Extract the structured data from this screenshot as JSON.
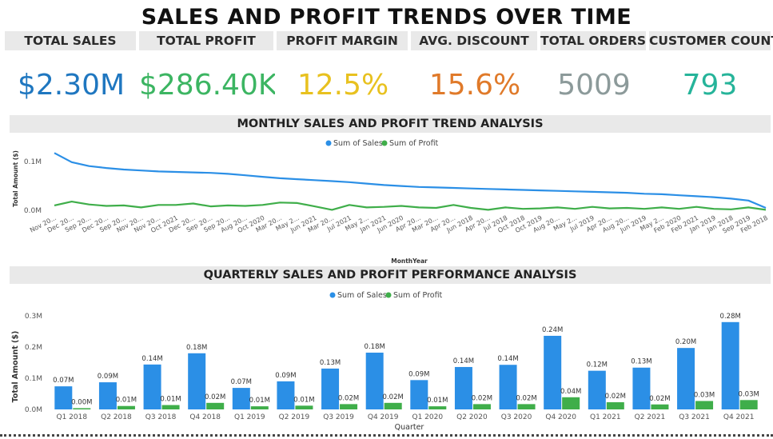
{
  "title": "SALES AND PROFIT TRENDS OVER TIME",
  "kpis": [
    {
      "label": "TOTAL SALES",
      "value": "$2.30M",
      "color": "#1f77c0"
    },
    {
      "label": "TOTAL PROFIT",
      "value": "$286.40K",
      "color": "#3cb562"
    },
    {
      "label": "PROFIT MARGIN",
      "value": "12.5%",
      "color": "#e8c11f"
    },
    {
      "label": "AVG. DISCOUNT",
      "value": "15.6%",
      "color": "#e07a2a"
    },
    {
      "label": "TOTAL ORDERS",
      "value": "5009",
      "color": "#8c9a9a"
    },
    {
      "label": "CUSTOMER COUNT",
      "value": "793",
      "color": "#26b49a"
    }
  ],
  "monthly": {
    "heading": "MONTHLY SALES AND PROFIT TREND ANALYSIS"
  },
  "quarterly": {
    "heading": "QUARTERLY SALES AND PROFIT PERFORMANCE ANALYSIS"
  },
  "chart_data": [
    {
      "type": "line",
      "title": "MONTHLY SALES AND PROFIT TREND ANALYSIS",
      "xlabel": "MonthYear",
      "ylabel": "Total Amount ($)",
      "ylim": [
        0,
        0.13
      ],
      "yticks": [
        {
          "value": 0,
          "label": "0.0M"
        },
        {
          "value": 0.1,
          "label": "0.1M"
        }
      ],
      "legend": "top-center",
      "colors": {
        "Sum of Sales": "#2b8fe6",
        "Sum of Profit": "#3fae4a"
      },
      "x": [
        "Nov 20...",
        "Dec 20...",
        "Sep 20...",
        "Dec 20...",
        "Sep 20...",
        "Nov 20...",
        "Nov 20...",
        "Oct 2021",
        "Dec 20...",
        "Sep 20...",
        "Sep 20...",
        "Aug 20...",
        "Oct 2020",
        "Mar 20...",
        "May 2...",
        "Jun 2021",
        "Mar 20...",
        "Jul 2021",
        "May 2...",
        "Jan 2021",
        "Jun 2020",
        "Apr 20...",
        "Mar 20...",
        "Apr 20...",
        "Jun 2018",
        "Apr 20...",
        "Jul 2018",
        "Oct 2018",
        "Oct 2019",
        "Aug 20...",
        "May 2...",
        "Jul 2019",
        "Apr 20...",
        "Aug 20...",
        "Jun 2019",
        "May 2...",
        "Feb 2020",
        "Feb 2021",
        "Jan 2019",
        "Jan 2018",
        "Sep 2019",
        "Feb 2018"
      ],
      "series": [
        {
          "name": "Sum of Sales",
          "values": [
            0.118,
            0.099,
            0.091,
            0.087,
            0.084,
            0.082,
            0.08,
            0.079,
            0.078,
            0.077,
            0.075,
            0.072,
            0.069,
            0.066,
            0.064,
            0.062,
            0.06,
            0.058,
            0.055,
            0.052,
            0.05,
            0.048,
            0.047,
            0.046,
            0.045,
            0.044,
            0.043,
            0.042,
            0.041,
            0.04,
            0.039,
            0.038,
            0.037,
            0.036,
            0.034,
            0.033,
            0.031,
            0.029,
            0.027,
            0.024,
            0.02,
            0.005
          ]
        },
        {
          "name": "Sum of Profit",
          "values": [
            0.01,
            0.018,
            0.012,
            0.009,
            0.01,
            0.006,
            0.011,
            0.011,
            0.014,
            0.008,
            0.01,
            0.009,
            0.011,
            0.016,
            0.015,
            0.008,
            0.001,
            0.011,
            0.006,
            0.007,
            0.009,
            0.006,
            0.005,
            0.011,
            0.005,
            0.001,
            0.006,
            0.003,
            0.004,
            0.006,
            0.003,
            0.007,
            0.004,
            0.005,
            0.003,
            0.006,
            0.003,
            0.007,
            0.003,
            0.002,
            0.006,
            0.001
          ]
        }
      ]
    },
    {
      "type": "bar",
      "title": "QUARTERLY SALES AND PROFIT PERFORMANCE ANALYSIS",
      "xlabel": "Quarter",
      "ylabel": "Total Amount ($)",
      "ylim": [
        0,
        0.3
      ],
      "yticks": [
        {
          "value": 0,
          "label": "0.0M"
        },
        {
          "value": 0.1,
          "label": "0.1M"
        },
        {
          "value": 0.2,
          "label": "0.2M"
        },
        {
          "value": 0.3,
          "label": "0.3M"
        }
      ],
      "legend": "top-center",
      "colors": {
        "Sum of Sales": "#2b8fe6",
        "Sum of Profit": "#3fae4a"
      },
      "categories": [
        "Q1 2018",
        "Q2 2018",
        "Q3 2018",
        "Q4 2018",
        "Q1 2019",
        "Q2 2019",
        "Q3 2019",
        "Q4 2019",
        "Q1 2020",
        "Q2 2020",
        "Q3 2020",
        "Q4 2020",
        "Q1 2021",
        "Q2 2021",
        "Q3 2021",
        "Q4 2021"
      ],
      "series": [
        {
          "name": "Sum of Sales",
          "values": [
            0.074,
            0.087,
            0.144,
            0.18,
            0.069,
            0.09,
            0.131,
            0.182,
            0.094,
            0.136,
            0.143,
            0.236,
            0.124,
            0.134,
            0.197,
            0.28
          ],
          "labels": [
            "0.07M",
            "0.09M",
            "0.14M",
            "0.18M",
            "0.07M",
            "0.09M",
            "0.13M",
            "0.18M",
            "0.09M",
            "0.14M",
            "0.14M",
            "0.24M",
            "0.12M",
            "0.13M",
            "0.20M",
            "0.28M"
          ]
        },
        {
          "name": "Sum of Profit",
          "values": [
            0.004,
            0.011,
            0.014,
            0.021,
            0.01,
            0.012,
            0.017,
            0.021,
            0.01,
            0.017,
            0.017,
            0.039,
            0.023,
            0.016,
            0.027,
            0.03
          ],
          "labels": [
            "0.00M",
            "0.01M",
            "0.01M",
            "0.02M",
            "0.01M",
            "0.01M",
            "0.02M",
            "0.02M",
            "0.01M",
            "0.02M",
            "0.02M",
            "0.04M",
            "0.02M",
            "0.02M",
            "0.03M",
            "0.03M"
          ]
        }
      ]
    }
  ]
}
